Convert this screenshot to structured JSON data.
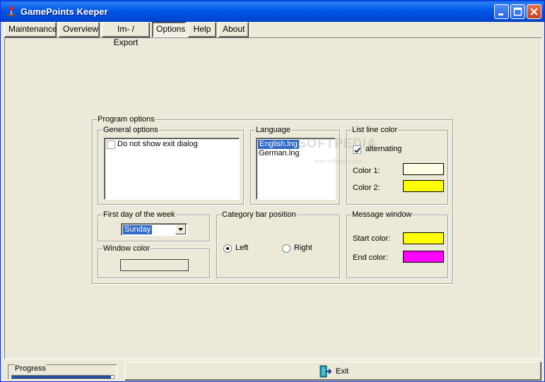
{
  "window": {
    "title": "GamePoints Keeper"
  },
  "menu": {
    "items": [
      {
        "label": "Maintenance"
      },
      {
        "label": "Overview"
      },
      {
        "label": "Im- / Export"
      },
      {
        "label": "Options"
      },
      {
        "label": "Help"
      },
      {
        "label": "About"
      }
    ],
    "active": "Options"
  },
  "program_options": {
    "title": "Program options",
    "general_options": {
      "title": "General options",
      "items": [
        {
          "label": "Do not show exit dialog",
          "checked": false
        }
      ]
    },
    "language": {
      "title": "Language",
      "items": [
        "English.lng",
        "German.lng"
      ],
      "selected": "English.lng"
    },
    "list_line_color": {
      "title": "List line color",
      "alternating_label": "alternating",
      "alternating_checked": true,
      "color1_label": "Color 1:",
      "color1": "#ffffe6",
      "color2_label": "Color 2:",
      "color2": "#ffff00"
    },
    "first_day": {
      "title": "First day of the week",
      "value": "Sunday"
    },
    "category_bar": {
      "title": "Category bar position",
      "options": [
        {
          "label": "Left",
          "selected": true
        },
        {
          "label": "Right",
          "selected": false
        }
      ]
    },
    "window_color": {
      "title": "Window color",
      "color": "#ece9d8"
    },
    "message_window": {
      "title": "Message window",
      "start_label": "Start color:",
      "start_color": "#ffff00",
      "end_label": "End color:",
      "end_color": "#ff00ff"
    }
  },
  "watermark": {
    "brand": "SOFTPEDIA",
    "url": "www.softpedia.com"
  },
  "status": {
    "progress_label": "Progress",
    "progress_fraction": 0.97,
    "exit_label": "Exit"
  },
  "colors": {
    "titlebar": "#0058e6",
    "selection": "#316ac5",
    "face": "#ece9d8"
  },
  "icons": [
    "app-joystick-icon",
    "minimize-icon",
    "maximize-icon",
    "close-icon",
    "exit-door-icon",
    "checkmark-icon",
    "dropdown-arrow-icon"
  ]
}
